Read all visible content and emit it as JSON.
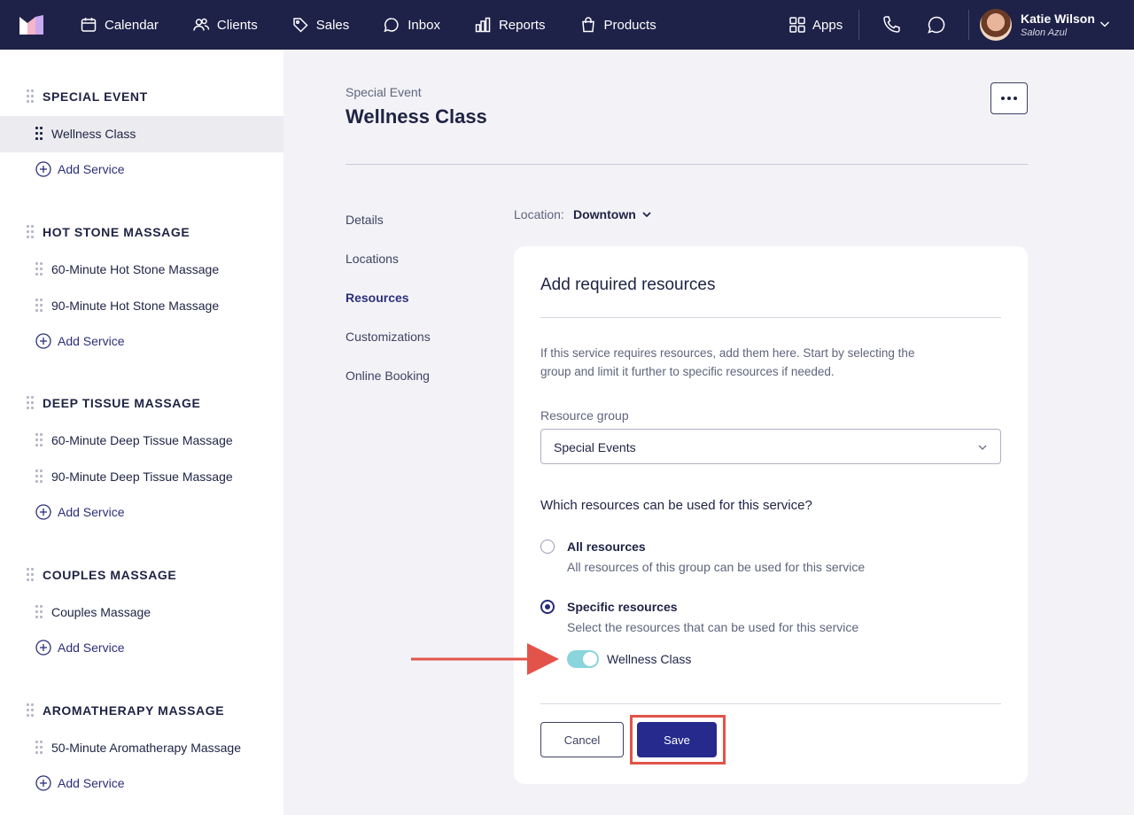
{
  "nav": {
    "items": [
      {
        "label": "Calendar",
        "icon": "calendar-icon"
      },
      {
        "label": "Clients",
        "icon": "users-icon"
      },
      {
        "label": "Sales",
        "icon": "tag-icon"
      },
      {
        "label": "Inbox",
        "icon": "chat-bubble-icon"
      },
      {
        "label": "Reports",
        "icon": "bar-chart-icon"
      },
      {
        "label": "Products",
        "icon": "shopping-bag-icon"
      }
    ],
    "apps_label": "Apps",
    "user_name": "Katie Wilson",
    "user_business": "Salon Azul"
  },
  "sidebar": {
    "add_service_label": "Add Service",
    "groups": [
      {
        "title": "SPECIAL EVENT",
        "services": [
          "Wellness Class"
        ]
      },
      {
        "title": "HOT STONE MASSAGE",
        "services": [
          "60-Minute Hot Stone Massage",
          "90-Minute Hot Stone Massage"
        ]
      },
      {
        "title": "DEEP TISSUE MASSAGE",
        "services": [
          "60-Minute Deep Tissue Massage",
          "90-Minute Deep Tissue Massage"
        ]
      },
      {
        "title": "COUPLES MASSAGE",
        "services": [
          "Couples Massage"
        ]
      },
      {
        "title": "AROMATHERAPY MASSAGE",
        "services": [
          "50-Minute Aromatherapy Massage"
        ]
      }
    ]
  },
  "main": {
    "breadcrumb": "Special Event",
    "title": "Wellness Class",
    "subnav": [
      "Details",
      "Locations",
      "Resources",
      "Customizations",
      "Online Booking"
    ],
    "subnav_active": "Resources",
    "location_label": "Location:",
    "location_value": "Downtown"
  },
  "card": {
    "title": "Add required resources",
    "description": "If this service requires resources, add them here. Start by selecting the group and limit it further to specific resources if needed.",
    "resource_group_label": "Resource group",
    "resource_group_value": "Special Events",
    "question": "Which resources can be used for this service?",
    "option_all_title": "All resources",
    "option_all_sub": "All resources of this group can be used for this service",
    "option_specific_title": "Specific resources",
    "option_specific_sub": "Select the resources that can be used for this service",
    "selected_option": "Specific resources",
    "resource_toggle_label": "Wellness Class",
    "resource_toggle_on": true,
    "cancel_label": "Cancel",
    "save_label": "Save"
  },
  "colors": {
    "nav_bg": "#1e2148",
    "accent": "#262a8c",
    "toggle_on": "#8ad4dc",
    "annotation": "#e2544a"
  }
}
